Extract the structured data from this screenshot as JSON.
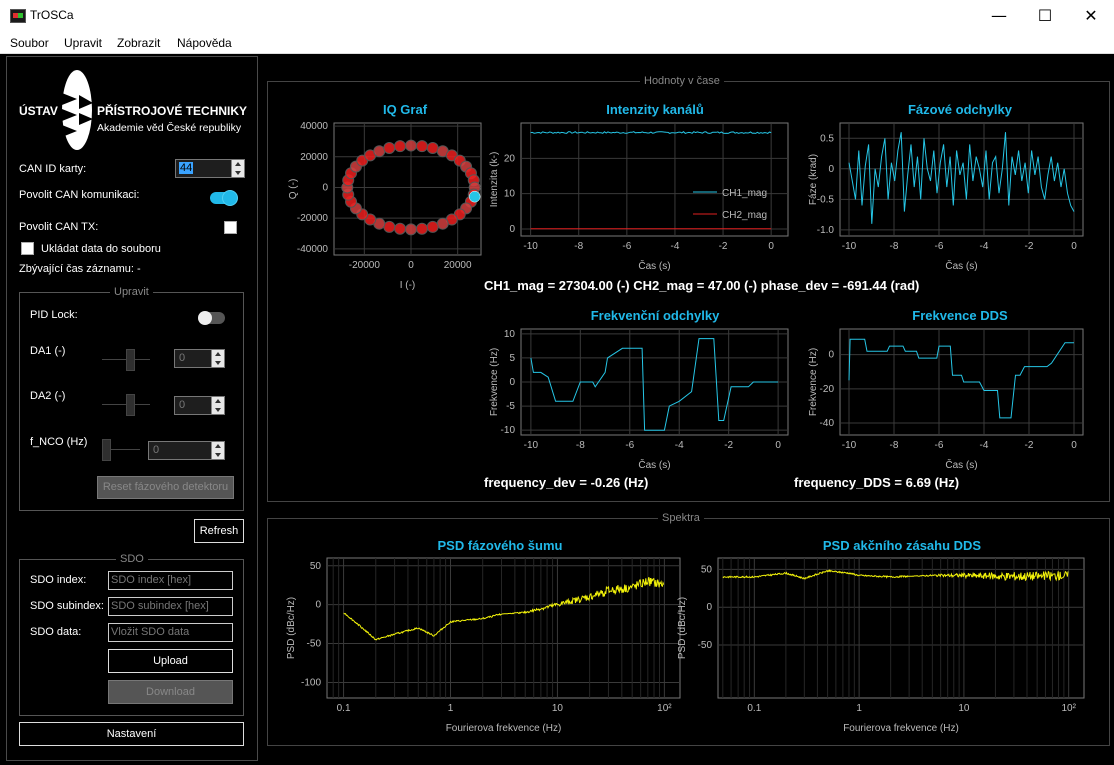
{
  "window": {
    "title": "TrOSCa",
    "minimize": "—",
    "maximize": "☐",
    "close": "✕"
  },
  "menu": [
    "Soubor",
    "Upravit",
    "Zobrazit",
    "Nápověda"
  ],
  "logo": {
    "word1": "ÚSTAV",
    "word2": "PŘÍSTROJOVÉ TECHNIKY",
    "subtitle": "Akademie věd České republiky"
  },
  "sidebar": {
    "can_id_label": "CAN ID karty:",
    "can_id_value": "44",
    "can_enable_label": "Povolit CAN komunikaci:",
    "can_enable_on": true,
    "can_tx_label": "Povolit CAN TX:",
    "save_data_label": "Ukládat data do souboru",
    "remaining_label": "Zbývající čas záznamu: -",
    "edit_group": {
      "title": "Upravit",
      "pid_lock_label": "PID Lock:",
      "da1_label": "DA1 (-)",
      "da1_value": "0",
      "da2_label": "DA2 (-)",
      "da2_value": "0",
      "fnco_label": "f_NCO (Hz)",
      "fnco_value": "0",
      "reset_label": "Reset fázového detektoru"
    },
    "refresh_label": "Refresh",
    "sdo_group": {
      "title": "SDO",
      "index_label": "SDO index:",
      "index_placeholder": "SDO index [hex]",
      "subindex_label": "SDO subindex:",
      "subindex_placeholder": "SDO subindex [hex]",
      "data_label": "SDO data:",
      "data_placeholder": "Vložit SDO data",
      "upload_label": "Upload",
      "download_label": "Download"
    },
    "settings_label": "Nastavení"
  },
  "time_panel": {
    "title": "Hodnoty v čase",
    "readout_main": "CH1_mag = 27304.00 (-)  CH2_mag = 47.00 (-)  phase_dev = -691.44 (rad)",
    "readout_freq": "frequency_dev = -0.26 (Hz)",
    "readout_dds": "frequency_DDS = 6.69 (Hz)"
  },
  "spectra_panel": {
    "title": "Spektra"
  },
  "colors": {
    "accent": "#21b9e9",
    "series_cyan": "#26c6e6",
    "series_red": "#e02020",
    "psd_yellow": "#f2f20a",
    "grid": "#3a3a3a"
  },
  "chart_data": [
    {
      "id": "iq",
      "type": "scatter",
      "title": "IQ Graf",
      "xlabel": "I (-)",
      "ylabel": "Q (-)",
      "xlim": [
        -33000,
        30000
      ],
      "ylim": [
        -44000,
        42000
      ],
      "xticks": [
        "-20000",
        "0",
        "20000"
      ],
      "xtickvals": [
        -20000,
        0,
        20000
      ],
      "yticks": [
        "40000",
        "20000",
        "0",
        "-20000",
        "-40000"
      ],
      "ytickvals": [
        40000,
        20000,
        0,
        -20000,
        -40000
      ],
      "points": [
        [
          0,
          27300
        ],
        [
          4700,
          26900
        ],
        [
          9300,
          25700
        ],
        [
          13600,
          23600
        ],
        [
          17500,
          20900
        ],
        [
          20900,
          17500
        ],
        [
          23600,
          13600
        ],
        [
          25700,
          9300
        ],
        [
          26900,
          4700
        ],
        [
          27300,
          0
        ],
        [
          26900,
          -4700
        ],
        [
          25700,
          -9300
        ],
        [
          23600,
          -13600
        ],
        [
          20900,
          -17500
        ],
        [
          17500,
          -20900
        ],
        [
          13600,
          -23600
        ],
        [
          9300,
          -25700
        ],
        [
          4700,
          -26900
        ],
        [
          0,
          -27300
        ],
        [
          -4700,
          -26900
        ],
        [
          -9300,
          -25700
        ],
        [
          -13600,
          -23600
        ],
        [
          -17500,
          -20900
        ],
        [
          -20900,
          -17500
        ],
        [
          -23600,
          -13600
        ],
        [
          -25700,
          -9300
        ],
        [
          -26900,
          -4700
        ],
        [
          -27300,
          0
        ],
        [
          -26900,
          4700
        ],
        [
          -25700,
          9300
        ],
        [
          -23600,
          13600
        ],
        [
          -20900,
          17500
        ],
        [
          -17500,
          20900
        ],
        [
          -13600,
          23600
        ],
        [
          -9300,
          25700
        ],
        [
          -4700,
          26900
        ]
      ],
      "highlight": [
        27300,
        -6000
      ]
    },
    {
      "id": "mag",
      "type": "line",
      "title": "Intenzity kanálů",
      "xlabel": "Čas (s)",
      "ylabel": "Intenzita (k-)",
      "xlim": [
        -10.4,
        0.7
      ],
      "ylim": [
        -2,
        30
      ],
      "xticks": [
        "-10",
        "-8",
        "-6",
        "-4",
        "-2",
        "0"
      ],
      "xtickvals": [
        -10,
        -8,
        -6,
        -4,
        -2,
        0
      ],
      "yticks": [
        "20",
        "10",
        "0"
      ],
      "ytickvals": [
        20,
        10,
        0
      ],
      "legend": [
        "CH1_mag",
        "CH2_mag"
      ],
      "series": [
        {
          "name": "CH1_mag",
          "y": 27.3
        },
        {
          "name": "CH2_mag",
          "y": 0.05
        }
      ]
    },
    {
      "id": "phase",
      "type": "line",
      "title": "Fázové odchylky",
      "xlabel": "Čas (s)",
      "ylabel": "Fáze (krad)",
      "xlim": [
        -10.4,
        0.4
      ],
      "ylim": [
        -1.1,
        0.75
      ],
      "xticks": [
        "-10",
        "-8",
        "-6",
        "-4",
        "-2",
        "0"
      ],
      "xtickvals": [
        -10,
        -8,
        -6,
        -4,
        -2,
        0
      ],
      "yticks": [
        "0.5",
        "0",
        "-0.5",
        "-1.0"
      ],
      "ytickvals": [
        0.5,
        0,
        -0.5,
        -1.0
      ],
      "y": [
        0.1,
        -0.2,
        -0.5,
        0.3,
        -0.6,
        0.05,
        0.4,
        -0.9,
        0.0,
        -0.3,
        0.2,
        0.5,
        -0.5,
        0.1,
        -0.2,
        0.3,
        0.6,
        -0.7,
        -0.1,
        0.4,
        -0.3,
        0.2,
        -0.5,
        0.5,
        0.0,
        -0.2,
        0.3,
        -0.4,
        0.1,
        0.4,
        -0.3,
        0.2,
        -0.6,
        0.3,
        -0.1,
        0.1,
        -0.5,
        0.4,
        -0.2,
        0.2,
        0.0,
        -0.3,
        0.3,
        -0.5,
        0.1,
        0.2,
        -0.4,
        0.0,
        0.6,
        -0.6,
        0.2,
        -0.1,
        0.3,
        -0.2,
        0.1,
        -0.4,
        0.3,
        -0.1,
        0.2,
        -0.3,
        -0.5,
        -0.1,
        0.2,
        -0.2,
        0.1,
        -0.3,
        0.0,
        -0.4,
        -0.6,
        -0.7
      ]
    },
    {
      "id": "fdev",
      "type": "line",
      "title": "Frekvenční odchylky",
      "xlabel": "Čas (s)",
      "ylabel": "Frekvence (Hz)",
      "xlim": [
        -10.4,
        0.4
      ],
      "ylim": [
        -11,
        11
      ],
      "xticks": [
        "-10",
        "-8",
        "-6",
        "-4",
        "-2",
        "0"
      ],
      "xtickvals": [
        -10,
        -8,
        -6,
        -4,
        -2,
        0
      ],
      "yticks": [
        "10",
        "5",
        "0",
        "-5",
        "-10"
      ],
      "ytickvals": [
        10,
        5,
        0,
        -5,
        -10
      ],
      "points": [
        [
          -10,
          5
        ],
        [
          -9.9,
          2
        ],
        [
          -9.6,
          2
        ],
        [
          -9.3,
          1
        ],
        [
          -9,
          -4
        ],
        [
          -8.3,
          -4
        ],
        [
          -8,
          0
        ],
        [
          -7.5,
          0
        ],
        [
          -7.4,
          -1
        ],
        [
          -7,
          2
        ],
        [
          -6.9,
          5
        ],
        [
          -6.3,
          7
        ],
        [
          -5.5,
          7
        ],
        [
          -5.4,
          -10
        ],
        [
          -4.6,
          -10
        ],
        [
          -4.4,
          -5
        ],
        [
          -4,
          -4
        ],
        [
          -3.5,
          -2
        ],
        [
          -3.2,
          9
        ],
        [
          -2.6,
          9
        ],
        [
          -2.4,
          -8
        ],
        [
          -2.2,
          -8
        ],
        [
          -1.9,
          -1
        ],
        [
          -1.2,
          -1
        ],
        [
          -1,
          0
        ],
        [
          -0.5,
          0
        ],
        [
          0,
          0
        ]
      ]
    },
    {
      "id": "dds",
      "type": "line",
      "title": "Frekvence DDS",
      "xlabel": "Čas (s)",
      "ylabel": "Frekvence (Hz)",
      "xlim": [
        -10.4,
        0.4
      ],
      "ylim": [
        -47,
        15
      ],
      "xticks": [
        "-10",
        "-8",
        "-6",
        "-4",
        "-2",
        "0"
      ],
      "xtickvals": [
        -10,
        -8,
        -6,
        -4,
        -2,
        0
      ],
      "yticks": [
        "0",
        "-20",
        "-40"
      ],
      "ytickvals": [
        0,
        -20,
        -40
      ],
      "points": [
        [
          -10,
          -15
        ],
        [
          -9.95,
          9
        ],
        [
          -9.3,
          9
        ],
        [
          -9.2,
          2
        ],
        [
          -8.3,
          2
        ],
        [
          -8.2,
          5
        ],
        [
          -7.6,
          5
        ],
        [
          -7.5,
          2
        ],
        [
          -7,
          2
        ],
        [
          -6.9,
          -2
        ],
        [
          -6.1,
          -2
        ],
        [
          -6,
          5
        ],
        [
          -5.5,
          5
        ],
        [
          -5.4,
          -12
        ],
        [
          -5,
          -12
        ],
        [
          -4.9,
          -16
        ],
        [
          -4.2,
          -16
        ],
        [
          -4,
          -21
        ],
        [
          -3.4,
          -21
        ],
        [
          -3.3,
          -37
        ],
        [
          -2.8,
          -37
        ],
        [
          -2.6,
          -12
        ],
        [
          -2.4,
          -12
        ],
        [
          -2.2,
          -7
        ],
        [
          -1.2,
          -7
        ],
        [
          -1,
          -5
        ],
        [
          -0.4,
          7
        ],
        [
          0,
          7
        ]
      ]
    },
    {
      "id": "psd_phase",
      "type": "line",
      "title": "PSD fázového šumu",
      "xlabel": "Fourierova frekvence (Hz)",
      "ylabel": "PSD (dBc/Hz)",
      "xscale": "log",
      "xlim": [
        0.07,
        140
      ],
      "ylim": [
        -120,
        60
      ],
      "xticks": [
        "0.1",
        "1",
        "10",
        "10²"
      ],
      "xtickvals": [
        0.1,
        1,
        10,
        100
      ],
      "yticks": [
        "50",
        "0",
        "-50",
        "-100"
      ],
      "ytickvals": [
        50,
        0,
        -50,
        -100
      ],
      "points": [
        [
          0.1,
          -10
        ],
        [
          0.15,
          -30
        ],
        [
          0.2,
          -45
        ],
        [
          0.3,
          -38
        ],
        [
          0.5,
          -30
        ],
        [
          0.7,
          -40
        ],
        [
          1,
          -22
        ],
        [
          2,
          -18
        ],
        [
          3,
          -12
        ],
        [
          5,
          -10
        ],
        [
          10,
          0
        ],
        [
          20,
          10
        ],
        [
          30,
          18
        ],
        [
          50,
          22
        ],
        [
          70,
          30
        ],
        [
          100,
          25
        ]
      ]
    },
    {
      "id": "psd_dds",
      "type": "line",
      "title": "PSD akčního zásahu DDS",
      "xlabel": "Fourierova frekvence (Hz)",
      "ylabel": "PSD (dBc/Hz)",
      "xscale": "log",
      "xlim": [
        0.045,
        140
      ],
      "ylim": [
        -120,
        65
      ],
      "xticks": [
        "0.1",
        "1",
        "10",
        "10²"
      ],
      "xtickvals": [
        0.1,
        1,
        10,
        100
      ],
      "yticks": [
        "50",
        "0",
        "-50"
      ],
      "ytickvals": [
        50,
        0,
        -50
      ],
      "points": [
        [
          0.05,
          40
        ],
        [
          0.1,
          40
        ],
        [
          0.2,
          45
        ],
        [
          0.3,
          38
        ],
        [
          0.5,
          48
        ],
        [
          0.8,
          45
        ],
        [
          1,
          42
        ],
        [
          2,
          40
        ],
        [
          5,
          42
        ],
        [
          10,
          42
        ],
        [
          20,
          41
        ],
        [
          50,
          41
        ],
        [
          100,
          42
        ]
      ]
    }
  ]
}
